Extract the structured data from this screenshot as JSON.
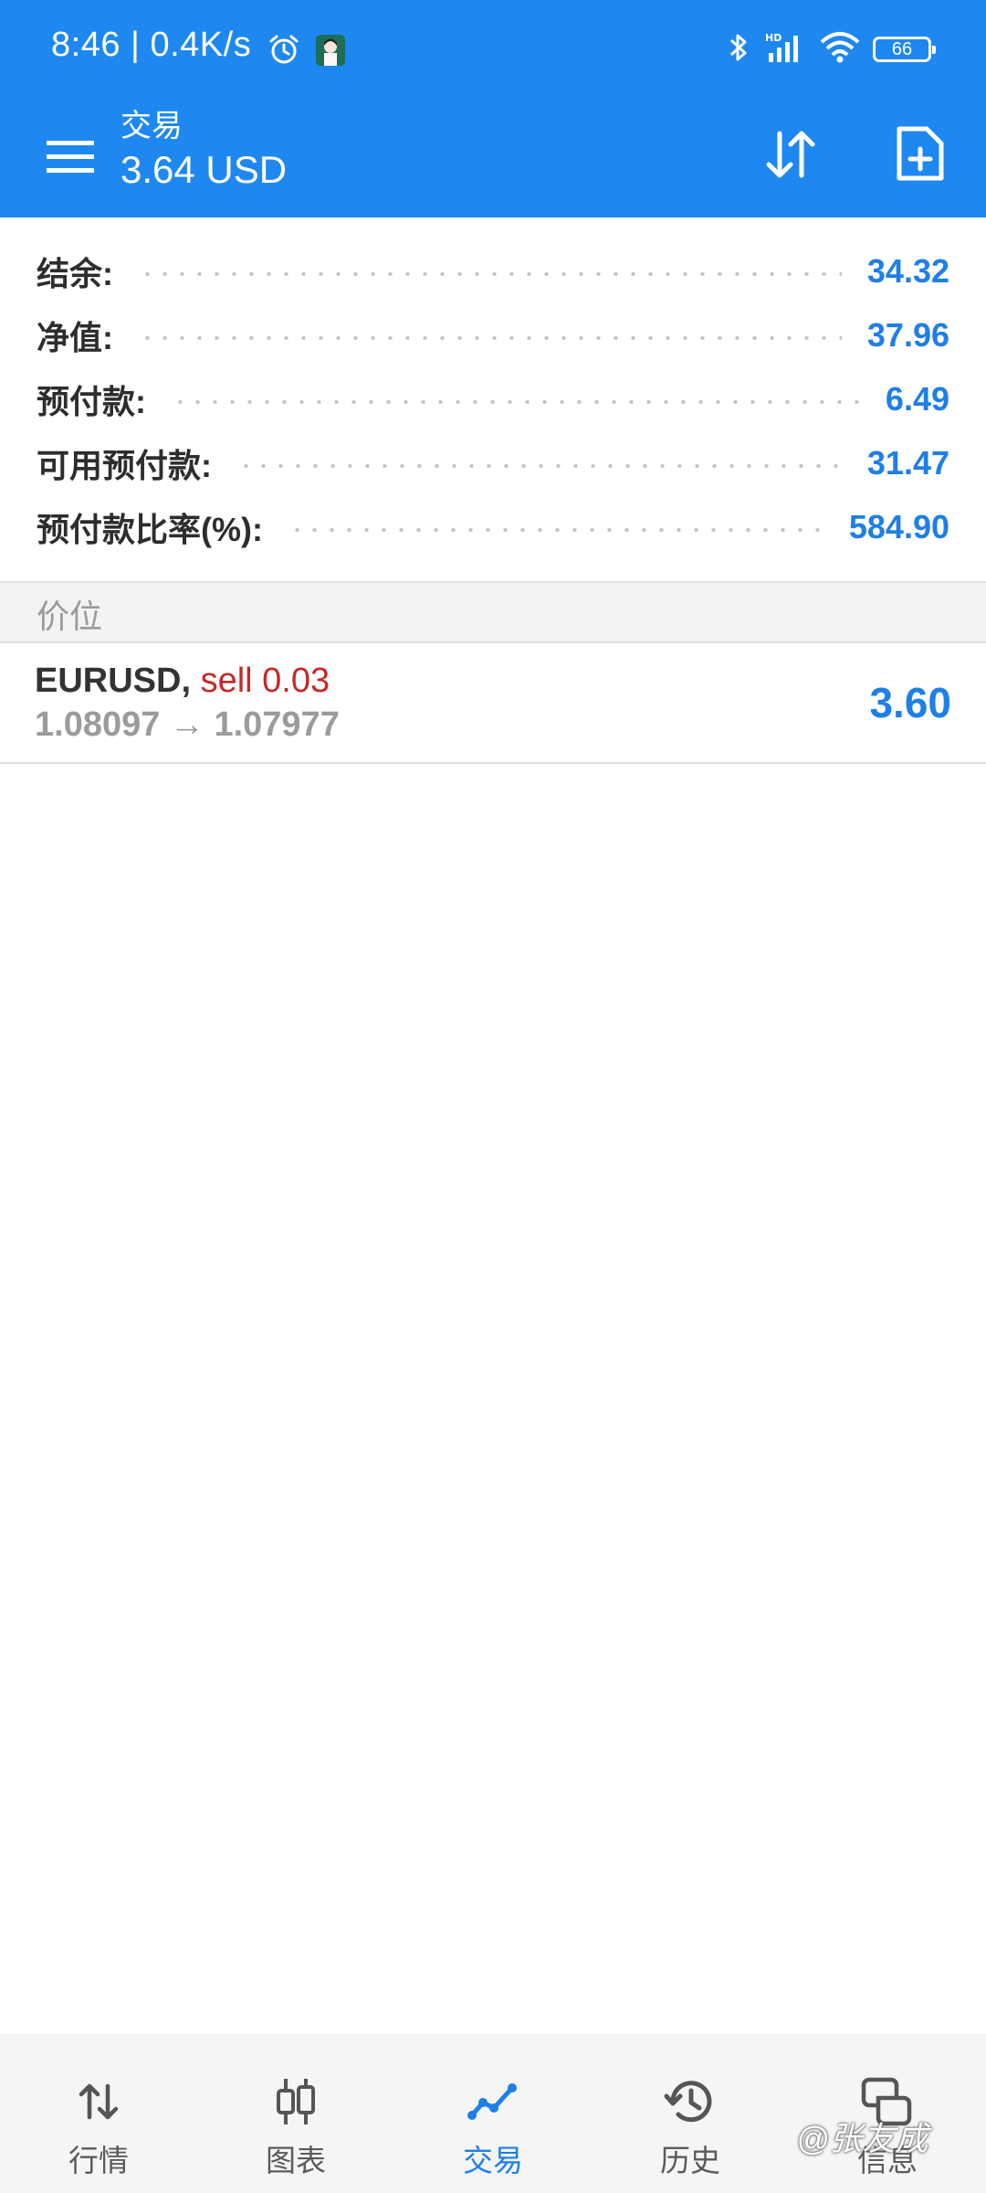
{
  "status_bar": {
    "time": "8:46",
    "network_speed": "| 0.4K/s",
    "icons": [
      "alarm-icon",
      "app-avatar-icon",
      "bluetooth-icon",
      "hd-signal-icon",
      "wifi-icon"
    ],
    "battery": "66"
  },
  "app_bar": {
    "subtitle": "交易",
    "title": "3.64 USD",
    "actions": [
      "sort-icon",
      "new-order-icon"
    ]
  },
  "summary": [
    {
      "label": "结余:",
      "value": "34.32"
    },
    {
      "label": "净值:",
      "value": "37.96"
    },
    {
      "label": "预付款:",
      "value": "6.49"
    },
    {
      "label": "可用预付款:",
      "value": "31.47"
    },
    {
      "label": "预付款比率(%):",
      "value": "584.90"
    }
  ],
  "section": {
    "label": "价位"
  },
  "positions": [
    {
      "symbol": "EURUSD,",
      "type": "sell 0.03",
      "prices": "1.08097 → 1.07977",
      "profit": "3.60"
    }
  ],
  "bottom_nav": [
    {
      "label": "行情",
      "icon": "quotes-icon",
      "active": false
    },
    {
      "label": "图表",
      "icon": "chart-icon",
      "active": false
    },
    {
      "label": "交易",
      "icon": "trade-icon",
      "active": true
    },
    {
      "label": "历史",
      "icon": "history-icon",
      "active": false
    },
    {
      "label": "信息",
      "icon": "messages-icon",
      "active": false
    }
  ],
  "watermark": "@张友成",
  "colors": {
    "primary": "#1e88f0",
    "value_blue": "#1e7fe6",
    "sell_red": "#c62828"
  }
}
